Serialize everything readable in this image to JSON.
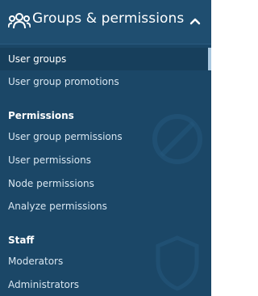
{
  "header": {
    "title": "Groups & permissions",
    "icon": "users-group-icon",
    "chevron": "chevron-up-icon"
  },
  "groups": [
    {
      "heading": "",
      "items": [
        {
          "label": "User groups",
          "active": true
        },
        {
          "label": "User group promotions",
          "active": false
        }
      ]
    },
    {
      "heading": "Permissions",
      "items": [
        {
          "label": "User group permissions",
          "active": false
        },
        {
          "label": "User permissions",
          "active": false
        },
        {
          "label": "Node permissions",
          "active": false
        },
        {
          "label": "Analyze permissions",
          "active": false
        }
      ]
    },
    {
      "heading": "Staff",
      "items": [
        {
          "label": "Moderators",
          "active": false
        },
        {
          "label": "Administrators",
          "active": false
        }
      ]
    }
  ],
  "colors": {
    "sidebar_bg": "#1b4767",
    "header_bg": "#1f4e70",
    "active_bg": "#173f5c",
    "active_indicator": "#a9c7df",
    "text": "#d8e6f1",
    "heading": "#ffffff"
  }
}
